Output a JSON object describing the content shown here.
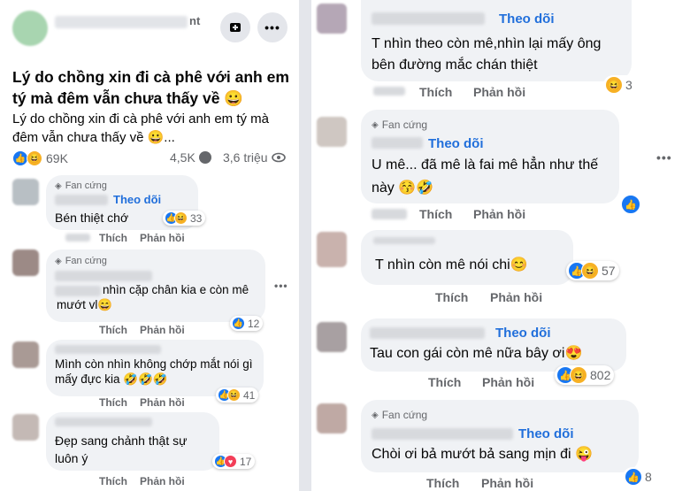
{
  "left": {
    "post": {
      "page_name": "nt",
      "title": "Lý do chồng xin đi cà phê với anh em tý mà đêm vẫn chưa thấy về 😀",
      "preview": "Lý do chồng xin đi cà phê với anh em tý mà đêm vẫn chưa thấy về 😀...",
      "reactions": "69K",
      "comments_count": "4,5K",
      "views": "3,6 triệu"
    },
    "comments": [
      {
        "badge": "Fan cứng",
        "follow": "Theo dõi",
        "text": "Bén thiệt chớ",
        "count": "33",
        "like": "Thích",
        "reply": "Phản hồi"
      },
      {
        "badge": "Fan cứng",
        "text": "nhìn cặp chân kia e còn mê mướt vl😄",
        "count": "12",
        "like": "Thích",
        "reply": "Phản hồi"
      },
      {
        "text": "Mình còn nhìn không chớp mắt nói gì mấy đực kia 🤣🤣🤣",
        "count": "41",
        "like": "Thích",
        "reply": "Phản hồi"
      },
      {
        "text": "Đẹp sang chảnh thật sự luôn ý",
        "count": "17",
        "like": "Thích",
        "reply": "Phản hồi"
      }
    ]
  },
  "right": {
    "comments": [
      {
        "follow": "Theo dõi",
        "text": "T nhìn theo còn mê,nhìn lại mấy ông bên đường mắc chán thiệt",
        "count": "3",
        "like": "Thích",
        "reply": "Phản hồi"
      },
      {
        "badge": "Fan cứng",
        "follow": "Theo dõi",
        "text": "U mê... đã mê là fai mê hẳn như thế này 😚🤣",
        "like": "Thích",
        "reply": "Phản hồi"
      },
      {
        "text": "T nhìn còn mê nói chi😊",
        "count": "57",
        "like": "Thích",
        "reply": "Phản hồi"
      },
      {
        "follow": "Theo dõi",
        "text": "Tau con gái còn mê nữa bây ơi😍",
        "count": "802",
        "like": "Thích",
        "reply": "Phản hồi"
      },
      {
        "badge": "Fan cứng",
        "follow": "Theo dõi",
        "text": "Chòi ơi bả mướt bả sang mịn đi 😜",
        "count": "8",
        "like": "Thích",
        "reply": "Phản hồi"
      }
    ]
  },
  "icons": {
    "like": "thumbs-up-icon",
    "haha": "laughing-face-icon",
    "love": "heart-icon",
    "comment": "comment-icon",
    "eye": "eye-icon",
    "badge": "diamond-icon"
  },
  "colors": {
    "follow": "#216fdb",
    "like": "#1877f2",
    "bubble": "#f0f2f5"
  }
}
